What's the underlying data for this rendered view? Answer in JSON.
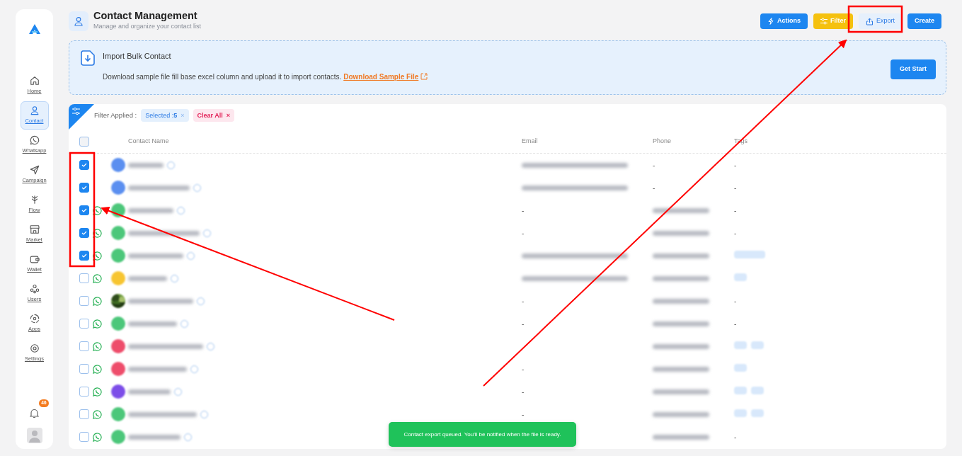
{
  "sidebar": {
    "items": [
      {
        "label": "Home",
        "selected": false
      },
      {
        "label": "Contact",
        "selected": true
      },
      {
        "label": "Whatsapp",
        "selected": false
      },
      {
        "label": "Campaign",
        "selected": false
      },
      {
        "label": "Flow",
        "selected": false
      },
      {
        "label": "Market",
        "selected": false
      },
      {
        "label": "Wallet",
        "selected": false
      },
      {
        "label": "Users",
        "selected": false
      },
      {
        "label": "Apps",
        "selected": false
      },
      {
        "label": "Settings",
        "selected": false
      }
    ],
    "notification_count": "46"
  },
  "header": {
    "title": "Contact Management",
    "subtitle": "Manage and organize your contact list",
    "buttons": [
      {
        "label": "Actions",
        "kind": "primary"
      },
      {
        "label": "Filter",
        "kind": "warning"
      },
      {
        "label": "Export",
        "kind": "light"
      },
      {
        "label": "Create",
        "kind": "primary"
      }
    ]
  },
  "import_banner": {
    "title": "Import Bulk Contact",
    "description": "Download sample file fill base excel column and upload it to import contacts.",
    "link": "Download Sample File",
    "button": "Get Start"
  },
  "filters": {
    "label": "Filter Applied :",
    "chips": [
      {
        "kind": "selected",
        "label": "Selected :",
        "value": "5",
        "remove": "×"
      },
      {
        "kind": "clear",
        "label": "Clear All",
        "remove": "×"
      }
    ]
  },
  "table": {
    "columns": [
      "Contact Name",
      "Email",
      "Phone",
      "Tags"
    ],
    "all_checked": false,
    "rows": [
      {
        "checked": true,
        "whatsapp": false,
        "avatar": {
          "kind": "initial",
          "color": "#5b8ff0"
        },
        "email": {
          "kind": "blurred"
        },
        "phone": {
          "kind": "text",
          "text": "-"
        },
        "tags": {
          "kind": "text",
          "text": "-"
        }
      },
      {
        "checked": true,
        "whatsapp": false,
        "avatar": {
          "kind": "initial",
          "color": "#5b8ff0"
        },
        "email": {
          "kind": "blurred"
        },
        "phone": {
          "kind": "text",
          "text": "-"
        },
        "tags": {
          "kind": "text",
          "text": "-"
        }
      },
      {
        "checked": true,
        "whatsapp": true,
        "avatar": {
          "kind": "initial",
          "color": "#4cc77a"
        },
        "email": {
          "kind": "text",
          "text": "-"
        },
        "phone": {
          "kind": "blurred"
        },
        "tags": {
          "kind": "text",
          "text": "-"
        }
      },
      {
        "checked": true,
        "whatsapp": true,
        "avatar": {
          "kind": "initial",
          "color": "#4cc77a"
        },
        "email": {
          "kind": "text",
          "text": "-"
        },
        "phone": {
          "kind": "blurred"
        },
        "tags": {
          "kind": "text",
          "text": "-"
        }
      },
      {
        "checked": true,
        "whatsapp": true,
        "avatar": {
          "kind": "initial",
          "color": "#4cc77a"
        },
        "email": {
          "kind": "blurred"
        },
        "phone": {
          "kind": "blurred"
        },
        "tags": {
          "kind": "pills",
          "pills": [
            {
              "kind": "wide"
            }
          ]
        }
      },
      {
        "checked": false,
        "whatsapp": true,
        "avatar": {
          "kind": "initial",
          "color": "#f7c531"
        },
        "email": {
          "kind": "blurred"
        },
        "phone": {
          "kind": "blurred"
        },
        "tags": {
          "kind": "pills",
          "pills": [
            {
              "kind": "narrow"
            }
          ]
        }
      },
      {
        "checked": false,
        "whatsapp": true,
        "email": {
          "kind": "text",
          "text": "-"
        },
        "phone": {
          "kind": "blurred"
        },
        "tags": {
          "kind": "text",
          "text": "-"
        }
      },
      {
        "checked": false,
        "whatsapp": true,
        "avatar": {
          "kind": "initial",
          "color": "#4cc77a"
        },
        "email": {
          "kind": "text",
          "text": "-"
        },
        "phone": {
          "kind": "blurred"
        },
        "tags": {
          "kind": "text",
          "text": "-"
        }
      },
      {
        "checked": false,
        "whatsapp": true,
        "avatar": {
          "kind": "initial",
          "color": "#ee4d6b"
        },
        "email": {
          "kind": "hidden"
        },
        "phone": {
          "kind": "blurred"
        },
        "tags": {
          "kind": "pills",
          "pills": [
            {
              "kind": "narrow"
            },
            {
              "kind": "narrow"
            }
          ]
        }
      },
      {
        "checked": false,
        "whatsapp": true,
        "avatar": {
          "kind": "initial",
          "color": "#ee4d6b"
        },
        "email": {
          "kind": "text",
          "text": "-"
        },
        "phone": {
          "kind": "blurred"
        },
        "tags": {
          "kind": "pills",
          "pills": [
            {
              "kind": "narrow"
            }
          ]
        }
      },
      {
        "checked": false,
        "whatsapp": true,
        "avatar": {
          "kind": "initial",
          "color": "#7c4de8"
        },
        "email": {
          "kind": "text",
          "text": "-"
        },
        "phone": {
          "kind": "blurred"
        },
        "tags": {
          "kind": "pills",
          "pills": [
            {
              "kind": "narrow"
            },
            {
              "kind": "narrow"
            }
          ]
        }
      },
      {
        "checked": false,
        "whatsapp": true,
        "avatar": {
          "kind": "initial",
          "color": "#4cc77a"
        },
        "email": {
          "kind": "text",
          "text": "-"
        },
        "phone": {
          "kind": "blurred"
        },
        "tags": {
          "kind": "pills",
          "pills": [
            {
              "kind": "narrow"
            },
            {
              "kind": "narrow"
            }
          ]
        }
      },
      {
        "checked": false,
        "whatsapp": true,
        "avatar": {
          "kind": "initial",
          "color": "#4cc77a"
        },
        "email": {
          "kind": "hidden"
        },
        "phone": {
          "kind": "blurred"
        },
        "tags": {
          "kind": "text",
          "text": "-"
        }
      }
    ]
  },
  "toast": {
    "message": "Contact export queued. You'll be notified when the file is ready."
  }
}
